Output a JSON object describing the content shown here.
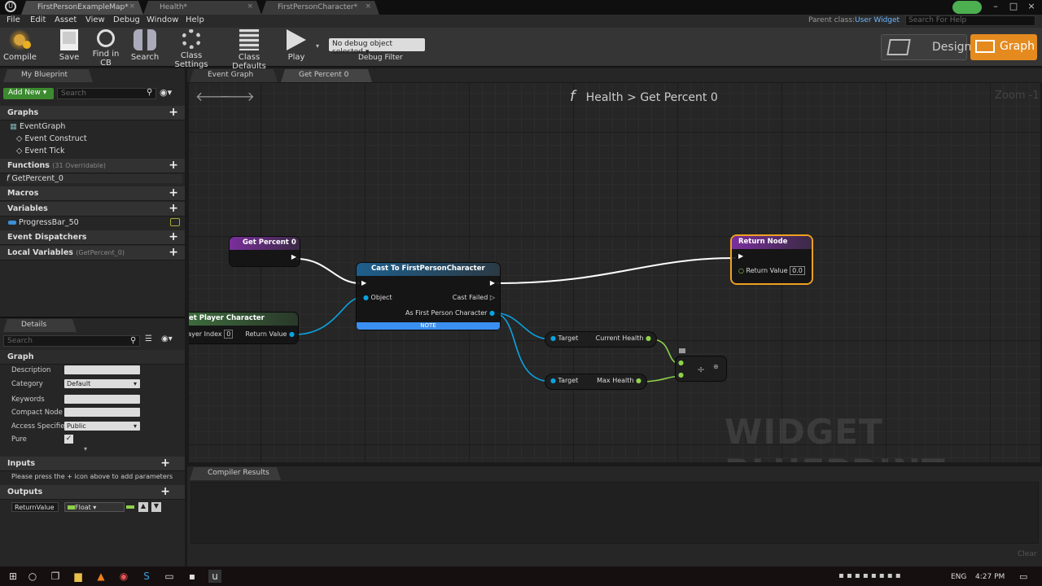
{
  "titlebar": {
    "tabs": [
      {
        "label": "FirstPersonExampleMap*"
      },
      {
        "label": "Health*"
      },
      {
        "label": "FirstPersonCharacter*"
      }
    ]
  },
  "menu": {
    "items": [
      "File",
      "Edit",
      "Asset",
      "View",
      "Debug",
      "Window",
      "Help"
    ],
    "parent_class_label": "Parent class:",
    "parent_class_value": "User Widget",
    "help_search_placeholder": "Search For Help"
  },
  "toolbar": {
    "buttons": [
      "Compile",
      "Save",
      "Find in CB",
      "Search",
      "Class Settings",
      "Class Defaults",
      "Play"
    ],
    "debug_object": "No debug object selected",
    "debug_filter": "Debug Filter",
    "mode_designer": "Designer",
    "mode_graph": "Graph"
  },
  "my_blueprint": {
    "tab": "My Blueprint",
    "add_new": "Add New",
    "search_placeholder": "Search",
    "sections": {
      "graphs": "Graphs",
      "functions": "Functions",
      "functions_sub": "(31 Overridable)",
      "macros": "Macros",
      "variables": "Variables",
      "dispatchers": "Event Dispatchers",
      "local_vars": "Local Variables",
      "local_vars_sub": "(GetPercent_0)"
    },
    "graph_items": [
      "EventGraph",
      "Event Construct",
      "Event Tick"
    ],
    "function_items": [
      "GetPercent_0"
    ],
    "variable_items": [
      "ProgressBar_50"
    ]
  },
  "details": {
    "tab": "Details",
    "search_placeholder": "Search",
    "section": "Graph",
    "rows": [
      {
        "label": "Description",
        "value": ""
      },
      {
        "label": "Category",
        "value": "Default"
      },
      {
        "label": "Keywords",
        "value": ""
      },
      {
        "label": "Compact Node",
        "value": ""
      },
      {
        "label": "Access Specifie",
        "value": "Public"
      },
      {
        "label": "Pure",
        "value": ""
      }
    ],
    "inputs": "Inputs",
    "inputs_hint": "Please press the + icon above to add parameters",
    "outputs": "Outputs",
    "output_name": "ReturnValue",
    "output_type": "Float"
  },
  "graph": {
    "tabs": [
      "Event Graph",
      "Get Percent 0"
    ],
    "breadcrumb_root": "Health",
    "breadcrumb_sep": ">",
    "breadcrumb_leaf": "Get Percent 0",
    "zoom": "Zoom -1",
    "watermark": "WIDGET BLUEPRINT",
    "nodes": {
      "entry": "Get Percent 0",
      "cast": "Cast To FirstPersonCharacter",
      "cast_object": "Object",
      "cast_failed": "Cast Failed",
      "cast_as": "As First Person Character",
      "cast_note": "NOTE",
      "getplayer": "et Player Character",
      "getplayer_index": "layer Index",
      "getplayer_index_val": "0",
      "getplayer_ret": "Return Value",
      "return": "Return Node",
      "return_val": "Return Value",
      "return_val_default": "0.0",
      "target1": "Target",
      "current_health": "Current Health",
      "target2": "Target",
      "max_health": "Max Health",
      "divide": "÷"
    }
  },
  "compiler": {
    "tab": "Compiler Results",
    "clear": "Clear"
  },
  "taskbar": {
    "lang": "ENG",
    "time": "4:27 PM"
  }
}
